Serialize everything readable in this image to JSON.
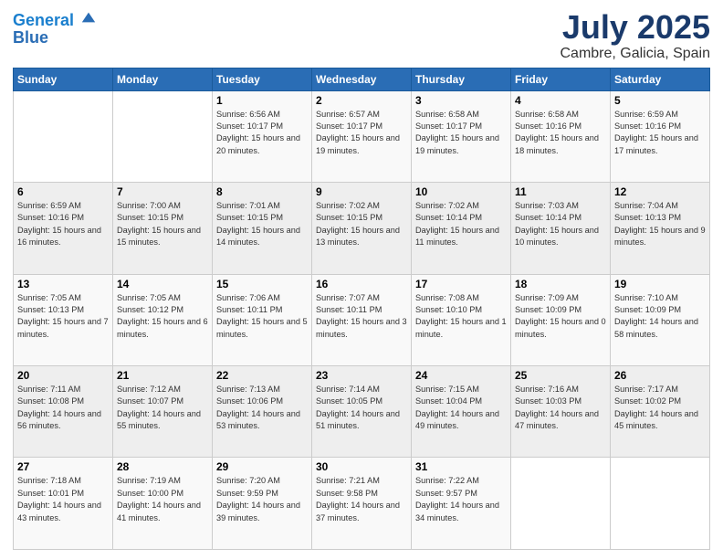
{
  "header": {
    "logo_line1": "General",
    "logo_line2": "Blue",
    "main_title": "July 2025",
    "subtitle": "Cambre, Galicia, Spain"
  },
  "calendar": {
    "days_of_week": [
      "Sunday",
      "Monday",
      "Tuesday",
      "Wednesday",
      "Thursday",
      "Friday",
      "Saturday"
    ],
    "weeks": [
      [
        {
          "day": "",
          "info": ""
        },
        {
          "day": "",
          "info": ""
        },
        {
          "day": "1",
          "info": "Sunrise: 6:56 AM\nSunset: 10:17 PM\nDaylight: 15 hours\nand 20 minutes."
        },
        {
          "day": "2",
          "info": "Sunrise: 6:57 AM\nSunset: 10:17 PM\nDaylight: 15 hours\nand 19 minutes."
        },
        {
          "day": "3",
          "info": "Sunrise: 6:58 AM\nSunset: 10:17 PM\nDaylight: 15 hours\nand 19 minutes."
        },
        {
          "day": "4",
          "info": "Sunrise: 6:58 AM\nSunset: 10:16 PM\nDaylight: 15 hours\nand 18 minutes."
        },
        {
          "day": "5",
          "info": "Sunrise: 6:59 AM\nSunset: 10:16 PM\nDaylight: 15 hours\nand 17 minutes."
        }
      ],
      [
        {
          "day": "6",
          "info": "Sunrise: 6:59 AM\nSunset: 10:16 PM\nDaylight: 15 hours\nand 16 minutes."
        },
        {
          "day": "7",
          "info": "Sunrise: 7:00 AM\nSunset: 10:15 PM\nDaylight: 15 hours\nand 15 minutes."
        },
        {
          "day": "8",
          "info": "Sunrise: 7:01 AM\nSunset: 10:15 PM\nDaylight: 15 hours\nand 14 minutes."
        },
        {
          "day": "9",
          "info": "Sunrise: 7:02 AM\nSunset: 10:15 PM\nDaylight: 15 hours\nand 13 minutes."
        },
        {
          "day": "10",
          "info": "Sunrise: 7:02 AM\nSunset: 10:14 PM\nDaylight: 15 hours\nand 11 minutes."
        },
        {
          "day": "11",
          "info": "Sunrise: 7:03 AM\nSunset: 10:14 PM\nDaylight: 15 hours\nand 10 minutes."
        },
        {
          "day": "12",
          "info": "Sunrise: 7:04 AM\nSunset: 10:13 PM\nDaylight: 15 hours\nand 9 minutes."
        }
      ],
      [
        {
          "day": "13",
          "info": "Sunrise: 7:05 AM\nSunset: 10:13 PM\nDaylight: 15 hours\nand 7 minutes."
        },
        {
          "day": "14",
          "info": "Sunrise: 7:05 AM\nSunset: 10:12 PM\nDaylight: 15 hours\nand 6 minutes."
        },
        {
          "day": "15",
          "info": "Sunrise: 7:06 AM\nSunset: 10:11 PM\nDaylight: 15 hours\nand 5 minutes."
        },
        {
          "day": "16",
          "info": "Sunrise: 7:07 AM\nSunset: 10:11 PM\nDaylight: 15 hours\nand 3 minutes."
        },
        {
          "day": "17",
          "info": "Sunrise: 7:08 AM\nSunset: 10:10 PM\nDaylight: 15 hours\nand 1 minute."
        },
        {
          "day": "18",
          "info": "Sunrise: 7:09 AM\nSunset: 10:09 PM\nDaylight: 15 hours\nand 0 minutes."
        },
        {
          "day": "19",
          "info": "Sunrise: 7:10 AM\nSunset: 10:09 PM\nDaylight: 14 hours\nand 58 minutes."
        }
      ],
      [
        {
          "day": "20",
          "info": "Sunrise: 7:11 AM\nSunset: 10:08 PM\nDaylight: 14 hours\nand 56 minutes."
        },
        {
          "day": "21",
          "info": "Sunrise: 7:12 AM\nSunset: 10:07 PM\nDaylight: 14 hours\nand 55 minutes."
        },
        {
          "day": "22",
          "info": "Sunrise: 7:13 AM\nSunset: 10:06 PM\nDaylight: 14 hours\nand 53 minutes."
        },
        {
          "day": "23",
          "info": "Sunrise: 7:14 AM\nSunset: 10:05 PM\nDaylight: 14 hours\nand 51 minutes."
        },
        {
          "day": "24",
          "info": "Sunrise: 7:15 AM\nSunset: 10:04 PM\nDaylight: 14 hours\nand 49 minutes."
        },
        {
          "day": "25",
          "info": "Sunrise: 7:16 AM\nSunset: 10:03 PM\nDaylight: 14 hours\nand 47 minutes."
        },
        {
          "day": "26",
          "info": "Sunrise: 7:17 AM\nSunset: 10:02 PM\nDaylight: 14 hours\nand 45 minutes."
        }
      ],
      [
        {
          "day": "27",
          "info": "Sunrise: 7:18 AM\nSunset: 10:01 PM\nDaylight: 14 hours\nand 43 minutes."
        },
        {
          "day": "28",
          "info": "Sunrise: 7:19 AM\nSunset: 10:00 PM\nDaylight: 14 hours\nand 41 minutes."
        },
        {
          "day": "29",
          "info": "Sunrise: 7:20 AM\nSunset: 9:59 PM\nDaylight: 14 hours\nand 39 minutes."
        },
        {
          "day": "30",
          "info": "Sunrise: 7:21 AM\nSunset: 9:58 PM\nDaylight: 14 hours\nand 37 minutes."
        },
        {
          "day": "31",
          "info": "Sunrise: 7:22 AM\nSunset: 9:57 PM\nDaylight: 14 hours\nand 34 minutes."
        },
        {
          "day": "",
          "info": ""
        },
        {
          "day": "",
          "info": ""
        }
      ]
    ]
  }
}
